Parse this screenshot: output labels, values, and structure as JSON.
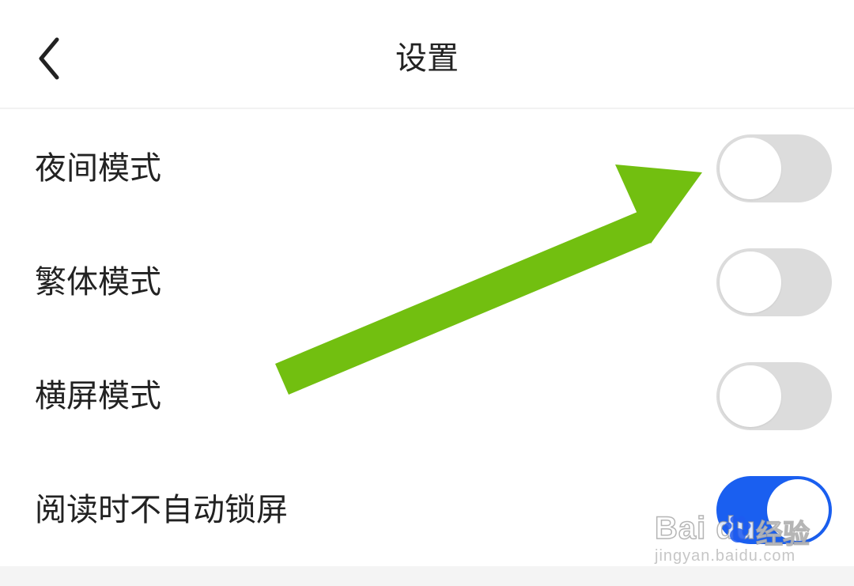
{
  "header": {
    "title": "设置",
    "back_icon": "chevron-left-icon"
  },
  "settings": {
    "items": [
      {
        "label": "夜间模式",
        "enabled": false
      },
      {
        "label": "繁体模式",
        "enabled": false
      },
      {
        "label": "横屏模式",
        "enabled": false
      },
      {
        "label": "阅读时不自动锁屏",
        "enabled": true
      }
    ]
  },
  "colors": {
    "toggle_on": "#1a5ff0",
    "toggle_off": "#dcdcdc",
    "annotation_arrow": "#72bf10"
  },
  "watermark": {
    "brand": "Bai du",
    "name": "经验",
    "url": "jingyan.baidu.com"
  }
}
